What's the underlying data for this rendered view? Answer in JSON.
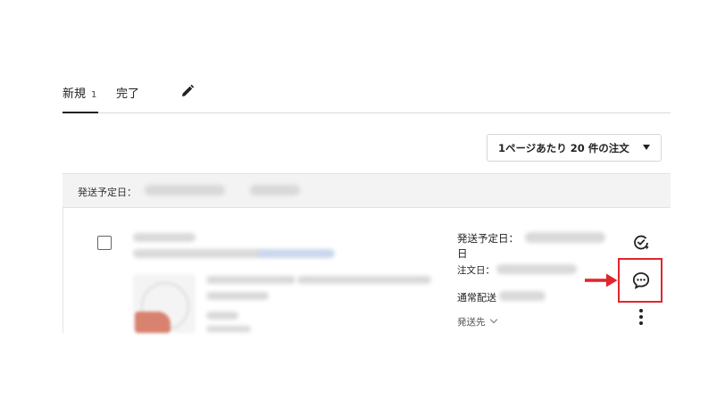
{
  "tabs": {
    "new_label": "新規",
    "new_count": "1",
    "done_label": "完了"
  },
  "perpage": {
    "label": "1ページあたり 20 件の注文"
  },
  "group": {
    "ship_date_label": "発送予定日："
  },
  "order": {
    "ship_date_label": "発送予定日：",
    "ship_date_suffix": "日",
    "order_date_label": "注文日：",
    "shipping_method": "通常配送",
    "destination_label": "発送先"
  },
  "icons": {
    "edit": "pencil-icon",
    "complete": "check-refresh-icon",
    "message": "chat-bubble-icon",
    "more": "more-vertical-icon",
    "caret": "caret-down-icon"
  },
  "colors": {
    "highlight": "#e0262d"
  }
}
